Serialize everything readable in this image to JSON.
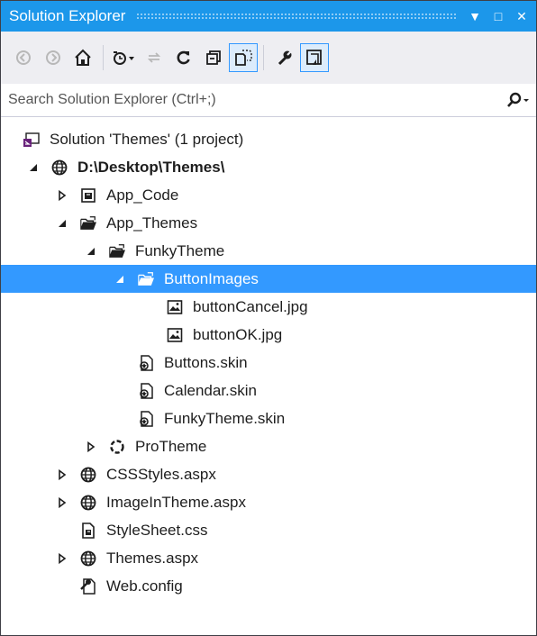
{
  "window": {
    "title": "Solution Explorer",
    "dropdown_glyph": "▼",
    "maximize_glyph": "□",
    "close_glyph": "✕"
  },
  "toolbar": {
    "buttons": [
      {
        "name": "back-icon",
        "disabled": true
      },
      {
        "name": "forward-icon",
        "disabled": true
      },
      {
        "name": "home-icon",
        "disabled": false
      },
      {
        "name": "pending-changes-filter-icon",
        "disabled": false
      },
      {
        "name": "sync-active-document-icon",
        "disabled": true
      },
      {
        "name": "refresh-icon",
        "disabled": false
      },
      {
        "name": "collapse-all-icon",
        "disabled": false
      },
      {
        "name": "show-all-files-icon",
        "disabled": false,
        "checked": true
      },
      {
        "name": "properties-icon",
        "disabled": false
      },
      {
        "name": "preview-selected-items-icon",
        "disabled": false,
        "checked": true
      }
    ]
  },
  "search": {
    "placeholder": "Search Solution Explorer (Ctrl+;)"
  },
  "tree": [
    {
      "label": "Solution 'Themes' (1 project)",
      "icon": "solution-icon",
      "expander": "none",
      "depth": 0
    },
    {
      "label": "D:\\Desktop\\Themes\\",
      "icon": "website-globe-icon",
      "expander": "expanded",
      "depth": 1,
      "bold": true
    },
    {
      "label": "App_Code",
      "icon": "special-folder-icon",
      "expander": "collapsed",
      "depth": 2
    },
    {
      "label": "App_Themes",
      "icon": "folder-open-icon",
      "expander": "expanded",
      "depth": 2
    },
    {
      "label": "FunkyTheme",
      "icon": "folder-open-icon",
      "expander": "expanded",
      "depth": 3
    },
    {
      "label": "ButtonImages",
      "icon": "folder-open-icon",
      "expander": "expanded",
      "depth": 4,
      "selected": true
    },
    {
      "label": "buttonCancel.jpg",
      "icon": "image-file-icon",
      "expander": "none",
      "depth": 5
    },
    {
      "label": "buttonOK.jpg",
      "icon": "image-file-icon",
      "expander": "none",
      "depth": 5
    },
    {
      "label": "Buttons.skin",
      "icon": "skin-file-icon",
      "expander": "none",
      "depth": 4
    },
    {
      "label": "Calendar.skin",
      "icon": "skin-file-icon",
      "expander": "none",
      "depth": 4
    },
    {
      "label": "FunkyTheme.skin",
      "icon": "skin-file-icon",
      "expander": "none",
      "depth": 4
    },
    {
      "label": "ProTheme",
      "icon": "theme-icon",
      "expander": "collapsed",
      "depth": 3
    },
    {
      "label": "CSSStyles.aspx",
      "icon": "aspx-globe-icon",
      "expander": "collapsed",
      "depth": 2
    },
    {
      "label": "ImageInTheme.aspx",
      "icon": "aspx-globe-icon",
      "expander": "collapsed",
      "depth": 2
    },
    {
      "label": "StyleSheet.css",
      "icon": "css-file-icon",
      "expander": "none",
      "depth": 2
    },
    {
      "label": "Themes.aspx",
      "icon": "aspx-globe-icon",
      "expander": "collapsed",
      "depth": 2
    },
    {
      "label": "Web.config",
      "icon": "config-file-icon",
      "expander": "none",
      "depth": 2
    }
  ],
  "colors": {
    "title_bar": "#1c97ea",
    "toolbar_bg": "#eeeef2",
    "selection": "#3399ff",
    "solution_purple": "#68217a"
  }
}
